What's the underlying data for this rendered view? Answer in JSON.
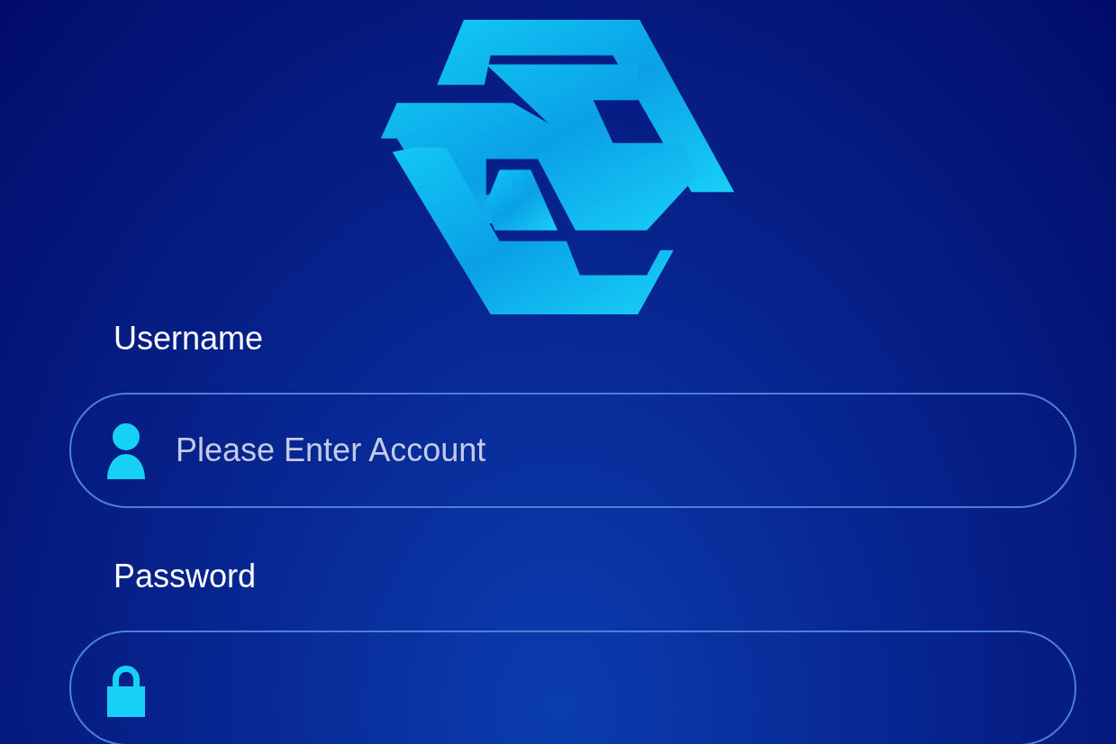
{
  "fields": [
    {
      "label": "Username",
      "kind": "user",
      "placeholder": "Please Enter Account"
    },
    {
      "label": "Password",
      "kind": "lock"
    }
  ]
}
